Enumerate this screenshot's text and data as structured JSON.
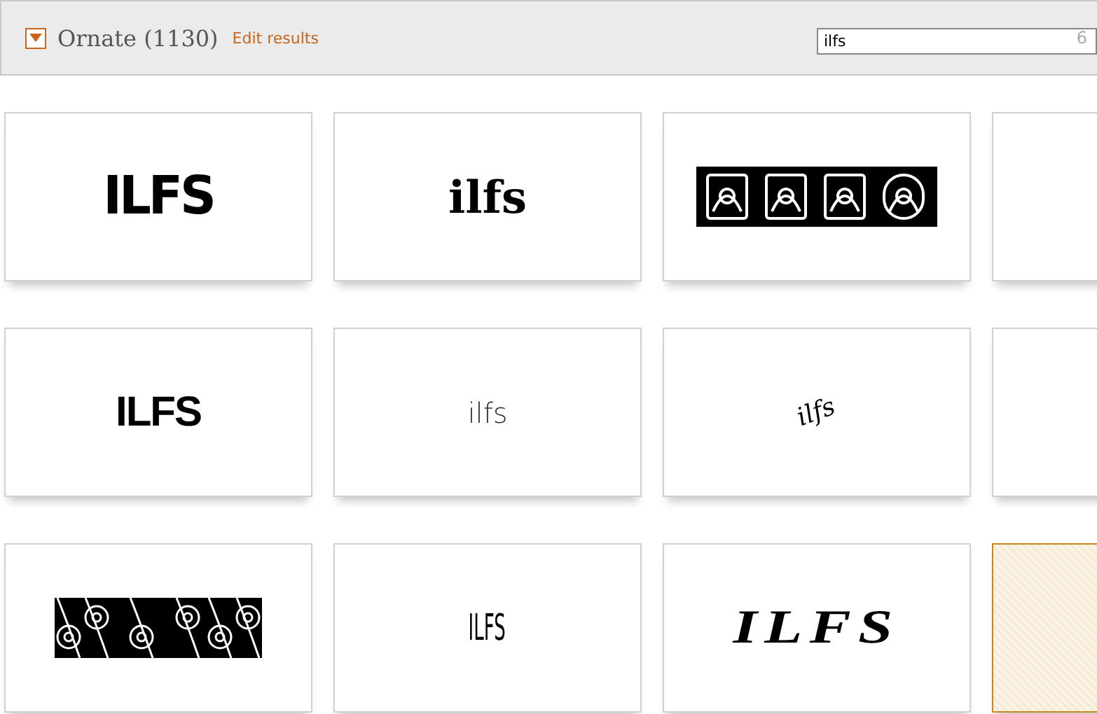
{
  "header": {
    "expanded": true,
    "title": "Ornate (1130)",
    "edit_link": "Edit results",
    "search": {
      "value": "ilfs",
      "count": "6"
    }
  },
  "cards": [
    {
      "kind": "text",
      "sample": "ILFS",
      "selected": false
    },
    {
      "kind": "text",
      "sample": "ilfs",
      "selected": false
    },
    {
      "kind": "ornament",
      "selected": false
    },
    {
      "kind": "blank",
      "selected": false
    },
    {
      "kind": "text",
      "sample": "ILFS",
      "selected": false
    },
    {
      "kind": "text",
      "sample": "ilfs",
      "selected": false
    },
    {
      "kind": "text",
      "sample": "ilfs",
      "selected": false
    },
    {
      "kind": "blank",
      "selected": false
    },
    {
      "kind": "ornament",
      "selected": false
    },
    {
      "kind": "text",
      "sample": "ILFS",
      "selected": false
    },
    {
      "kind": "text",
      "sample": "ILFS",
      "selected": false
    },
    {
      "kind": "blank",
      "selected": true
    }
  ]
}
